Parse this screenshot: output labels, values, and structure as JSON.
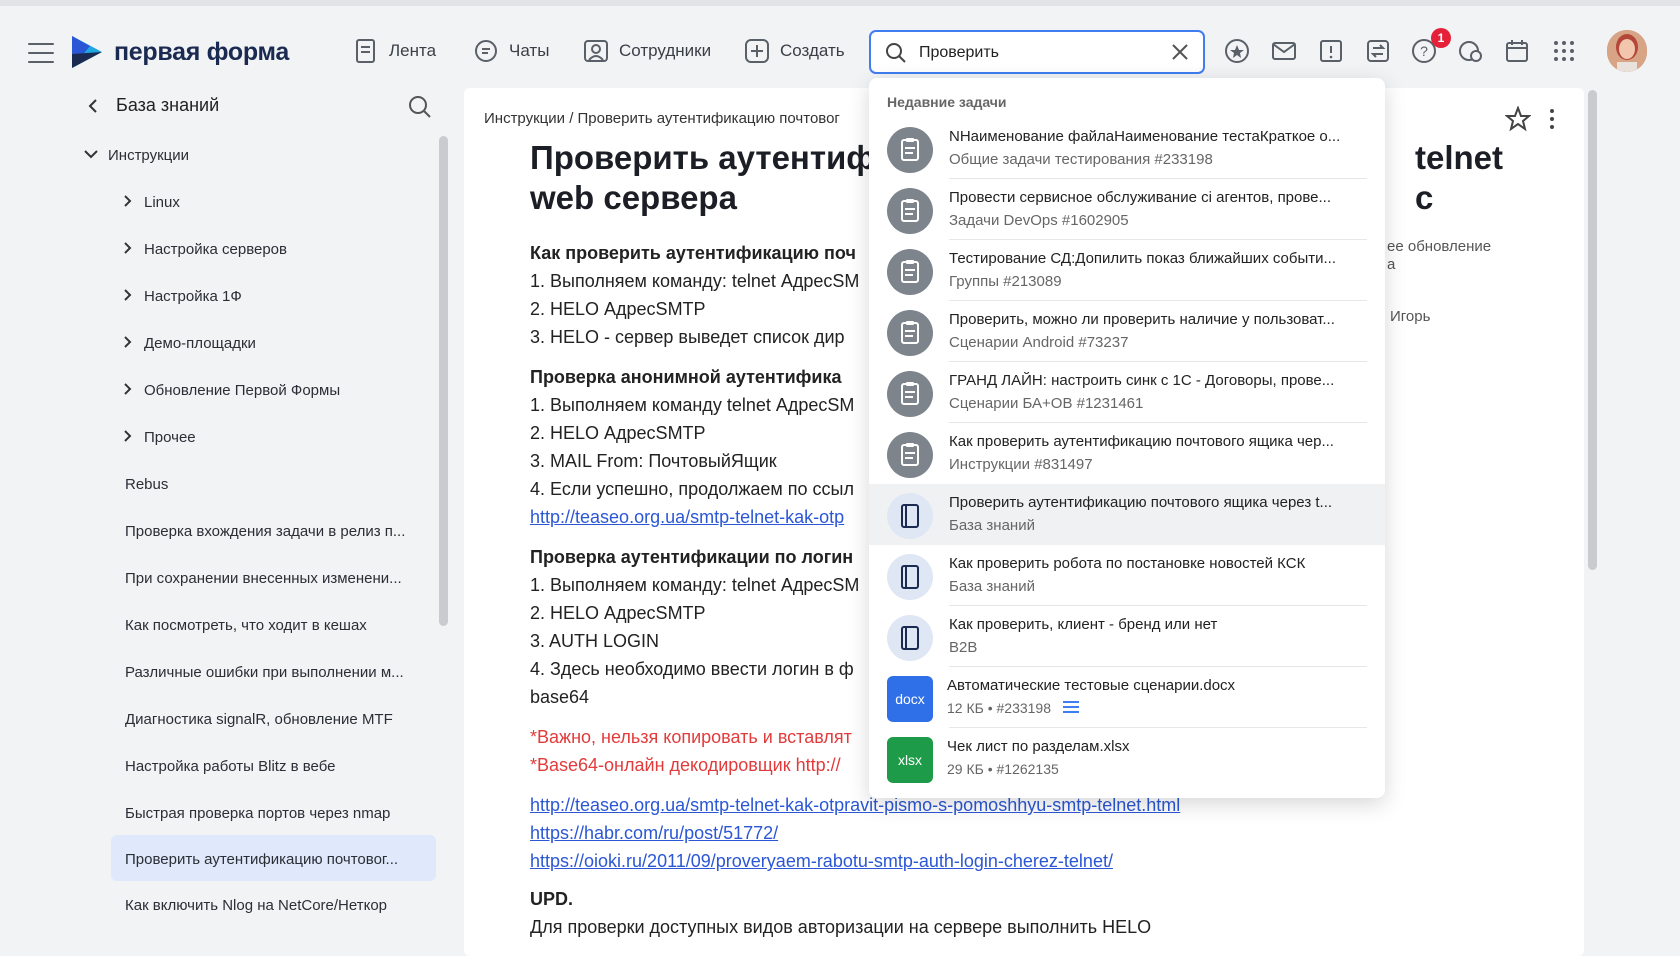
{
  "brand": {
    "name": "первая форма"
  },
  "nav": [
    {
      "label": "Лента",
      "icon": "feed-icon"
    },
    {
      "label": "Чаты",
      "icon": "chat-icon"
    },
    {
      "label": "Сотрудники",
      "icon": "employees-icon"
    },
    {
      "label": "Создать",
      "icon": "plus-icon"
    }
  ],
  "search": {
    "value": "Проверить",
    "placeholder": ""
  },
  "notifications": {
    "help_badge": "1"
  },
  "sidebar": {
    "title": "База знаний",
    "root": "Инструкции",
    "groups": [
      "Linux",
      "Настройка серверов",
      "Настройка 1Ф",
      "Демо-площадки",
      "Обновление Первой Формы",
      "Прочее"
    ],
    "items": [
      "Rebus",
      "Проверка вхождения задачи в релиз п...",
      "При сохранении внесенных изменени...",
      "Как посмотреть, что ходит в кешах",
      "Различные ошибки при выполнении м...",
      "Диагностика signalR, обновление MTF",
      "Настройка работы Blitz в вебе",
      "Быстрая проверка портов через nmap",
      "Проверить аутентификацию почтовог...",
      "Как включить Nlog на NetCore/Неткор"
    ]
  },
  "content": {
    "breadcrumb": "Инструкции / Проверить аутентификацию почтовог",
    "title_left": "Проверить аутентиф",
    "title_right": "telnet c",
    "title_line2": "web сервера",
    "side_note_1": "ее обновление",
    "side_note_2": "а",
    "side_note_3": "Игорь",
    "lines": [
      {
        "text": "Как проверить аутентификацию поч",
        "style": "b"
      },
      {
        "text": "1. Выполняем команду: telnet АдресSM",
        "style": ""
      },
      {
        "text": "2. HELO АдресSMTP",
        "style": ""
      },
      {
        "text": "3. HELO - сервер выведет список дир",
        "style": ""
      },
      {
        "text": "Проверка анонимной аутентифика",
        "style": "b"
      },
      {
        "text": "1. Выполняем команду telnet АдресSM",
        "style": ""
      },
      {
        "text": "2. HELO АдресSMTP",
        "style": ""
      },
      {
        "text": "3. MAIL From: ПочтовыйЯщик",
        "style": ""
      },
      {
        "text": "4. Если успешно, продолжаем по ссыл",
        "style": ""
      },
      {
        "text": "http://teaseo.org.ua/smtp-telnet-kak-otp",
        "style": "link"
      },
      {
        "text": "Проверка аутентификации по логин",
        "style": "b"
      },
      {
        "text": "1. Выполняем команду: telnet АдресSM",
        "style": ""
      },
      {
        "text": "2. HELO АдресSMTP",
        "style": ""
      },
      {
        "text": "3. AUTH LOGIN",
        "style": ""
      },
      {
        "text": "4. Здесь необходимо ввести логин в ф",
        "style": ""
      },
      {
        "text": "base64",
        "style": ""
      },
      {
        "text": "*Важно, нельзя копировать и вставлят",
        "style": "red"
      },
      {
        "text": "*Base64-онлайн декодировщик http://",
        "style": "red"
      },
      {
        "text": "http://teaseo.org.ua/smtp-telnet-kak-otpravit-pismo-s-pomoshhyu-smtp-telnet.html",
        "style": "link"
      },
      {
        "text": "https://habr.com/ru/post/51772/",
        "style": "link"
      },
      {
        "text": "https://oioki.ru/2011/09/proveryaem-rabotu-smtp-auth-login-cherez-telnet/",
        "style": "link"
      },
      {
        "text": "UPD.",
        "style": "b"
      },
      {
        "text": "Для проверки доступных видов авторизации на сервере выполнить HELO",
        "style": ""
      }
    ]
  },
  "dropdown": {
    "header": "Недавние задачи",
    "tasks": [
      {
        "title": "NНаименование файлаНаименование тестаКраткое о...",
        "sub": "Общие задачи тестирования #233198",
        "kind": "task"
      },
      {
        "title": "Провести сервисное обслуживание сі агентов, прове...",
        "sub": "Задачи DevOps #1602905",
        "kind": "task"
      },
      {
        "title": "Тестирование СД:Допилить показ ближайших событи...",
        "sub": "Группы #213089",
        "kind": "task"
      },
      {
        "title": "Проверить, можно ли проверить наличие у пользоват...",
        "sub": "Сценарии Android #73237",
        "kind": "task"
      },
      {
        "title": "ГРАНД ЛАЙН: настроить синк с 1С - Договоры, прове...",
        "sub": "Сценарии БА+ОВ #1231461",
        "kind": "task"
      },
      {
        "title": "Как проверить аутентификацию почтового ящика чер...",
        "sub": "Инструкции #831497",
        "kind": "task"
      },
      {
        "title": "Проверить аутентификацию почтового ящика через t...",
        "sub": "База знаний",
        "kind": "kb"
      },
      {
        "title": "Как проверить робота по постановке новостей КСК",
        "sub": "База знаний",
        "kind": "kb"
      },
      {
        "title": "Как проверить, клиент - бренд или нет",
        "sub": "B2B",
        "kind": "kb"
      }
    ],
    "files": [
      {
        "ext": "docx",
        "name": "Автоматические тестовые сценарии.docx",
        "size": "12 КБ",
        "task": "#233198",
        "color": "#2f6fe8"
      },
      {
        "ext": "xlsx",
        "name": "Чек лист по разделам.xlsx",
        "size": "29 КБ",
        "task": "#1262135",
        "color": "#1e9b48"
      }
    ]
  },
  "colors": {
    "accent": "#3f7df0",
    "badge": "#e5213a",
    "active_bg": "#dfe9fb",
    "error": "#e23b3b",
    "link": "#2b57d6"
  }
}
